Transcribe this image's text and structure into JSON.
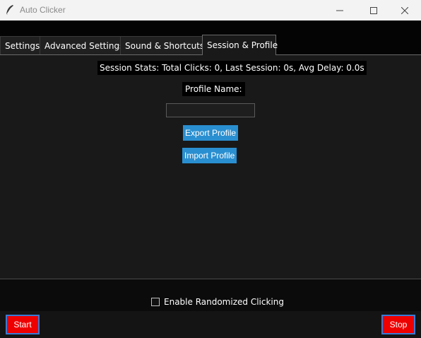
{
  "window": {
    "title": "Auto Clicker",
    "icon": "feather-icon",
    "controls": [
      "minimize-icon",
      "maximize-icon",
      "close-icon"
    ]
  },
  "tabs": [
    {
      "label": "Settings",
      "active": false
    },
    {
      "label": "Advanced Settings",
      "active": false
    },
    {
      "label": "Sound & Shortcuts",
      "active": false
    },
    {
      "label": "Session & Profile",
      "active": true
    }
  ],
  "session": {
    "stats": "Session Stats: Total Clicks: 0, Last Session: 0s, Avg Delay: 0.0s",
    "profile_label": "Profile Name:",
    "profile_value": "",
    "export_label": "Export Profile",
    "import_label": "Import Profile"
  },
  "options": {
    "randomized_label": "Enable Randomized Clicking",
    "randomized_checked": false
  },
  "footer": {
    "start_label": "Start",
    "stop_label": "Stop"
  },
  "colors": {
    "accent_blue": "#2a8fd0",
    "start_stop_red": "#ee0000",
    "panel_bg": "#191919"
  }
}
